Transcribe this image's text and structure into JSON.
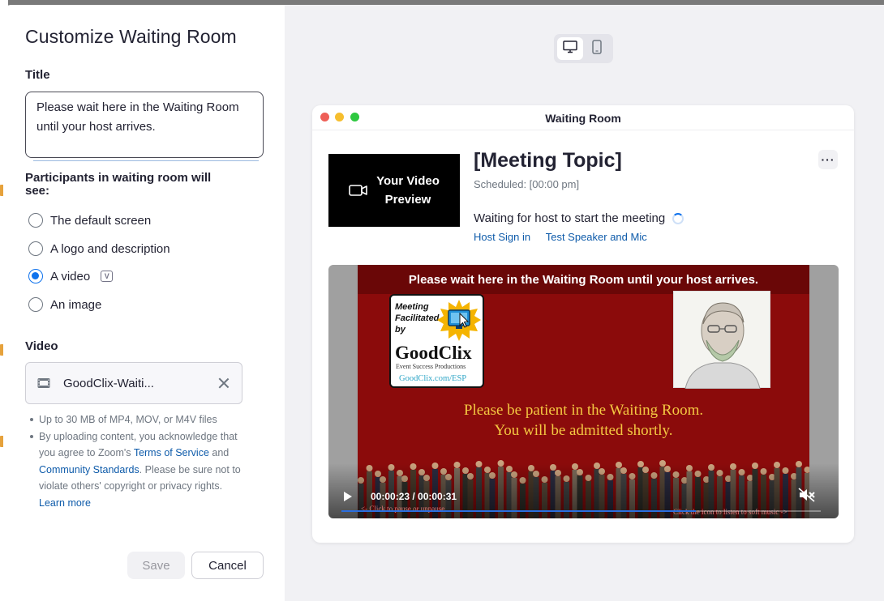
{
  "modal": {
    "title": "Customize Waiting Room"
  },
  "title_section": {
    "label": "Title",
    "value": "Please wait here in the Waiting Room until your host arrives."
  },
  "participants": {
    "label": "Participants in waiting room will see:",
    "options": [
      {
        "label": "The default screen",
        "checked": false
      },
      {
        "label": "A logo and description",
        "checked": false
      },
      {
        "label": "A video",
        "checked": true,
        "badge": "V"
      },
      {
        "label": "An image",
        "checked": false
      }
    ]
  },
  "video_section": {
    "label": "Video",
    "file_name": "GoodClix-Waiti...",
    "note_1": "Up to 30 MB of MP4, MOV, or M4V files",
    "note_2_prefix": "By uploading content, you acknowledge that you agree to Zoom's ",
    "terms_link": "Terms of Service",
    "and": " and ",
    "community_link": "Community Standards",
    "note_2_suffix": ". Please be sure not to violate others' copyright or privacy rights. ",
    "learn_more": "Learn more"
  },
  "buttons": {
    "save": "Save",
    "cancel": "Cancel"
  },
  "preview": {
    "window_title": "Waiting Room",
    "video_preview_label_1": "Your Video",
    "video_preview_label_2": "Preview",
    "meeting_topic": "[Meeting Topic]",
    "scheduled": "Scheduled: [00:00 pm]",
    "waiting_text": "Waiting for host to start the meeting",
    "host_sign_in": "Host Sign in",
    "test_speaker": "Test Speaker and Mic",
    "more_icon_text": "···"
  },
  "video_content": {
    "banner": "Please wait here in the Waiting Room until your host arrives.",
    "card_line_1": "Meeting",
    "card_line_2": "Facilitated",
    "card_line_3": "by",
    "card_brand": "GoodClix",
    "card_tagline": "Event Success Productions",
    "card_url": "GoodClix.com/ESP",
    "patient_1": "Please be patient in the Waiting Room.",
    "patient_2": "You will be admitted shortly.",
    "time": "00:00:23 / 00:00:31",
    "progress": 0.74,
    "hint_left": "<- Click to pause or unpause",
    "hint_right": "Click the icon to listen to soft music ->"
  },
  "colors": {
    "accent": "#0e72ed",
    "link": "#0e5baa",
    "video_red": "#8b0b0b",
    "video_text_gold": "#f4c842"
  }
}
